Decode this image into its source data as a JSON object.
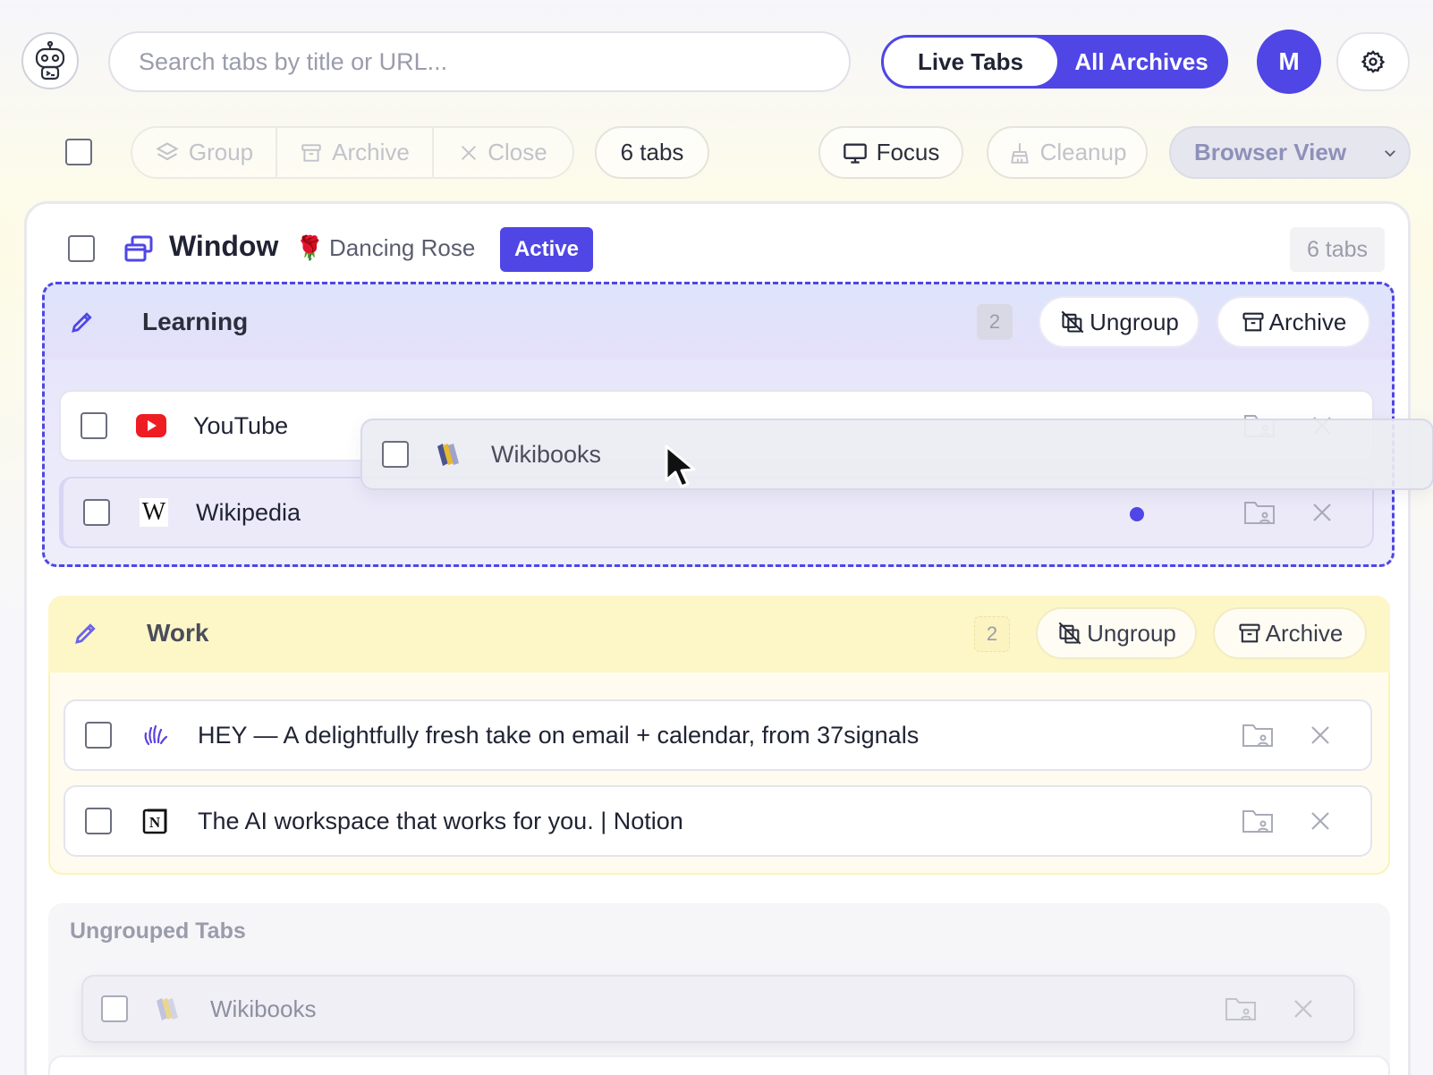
{
  "header": {
    "search_placeholder": "Search tabs by title or URL...",
    "view_toggle": {
      "live": "Live Tabs",
      "archives": "All Archives"
    },
    "avatar_initial": "M"
  },
  "toolbar": {
    "group": "Group",
    "archive": "Archive",
    "close": "Close",
    "tab_count": "6 tabs",
    "focus": "Focus",
    "cleanup": "Cleanup",
    "view_select": "Browser View"
  },
  "window": {
    "title": "Window",
    "emoji": "🌹",
    "name": "Dancing Rose",
    "badge": "Active",
    "count": "6 tabs"
  },
  "groups": [
    {
      "name": "Learning",
      "count": "2",
      "ungroup": "Ungroup",
      "archive": "Archive",
      "tabs": [
        {
          "title": "YouTube"
        },
        {
          "title": "Wikipedia"
        }
      ]
    },
    {
      "name": "Work",
      "count": "2",
      "ungroup": "Ungroup",
      "archive": "Archive",
      "tabs": [
        {
          "title": "HEY — A delightfully fresh take on email + calendar, from 37signals"
        },
        {
          "title": "The AI workspace that works for you. | Notion"
        }
      ]
    }
  ],
  "dragging_tab": {
    "title": "Wikibooks"
  },
  "ungrouped": {
    "title": "Ungrouped Tabs",
    "tabs": [
      {
        "title": "Wikibooks"
      }
    ]
  },
  "colors": {
    "accent": "#4f46e5",
    "learning_bg": "#e5e3fa",
    "work_bg": "#fdf6c7"
  }
}
